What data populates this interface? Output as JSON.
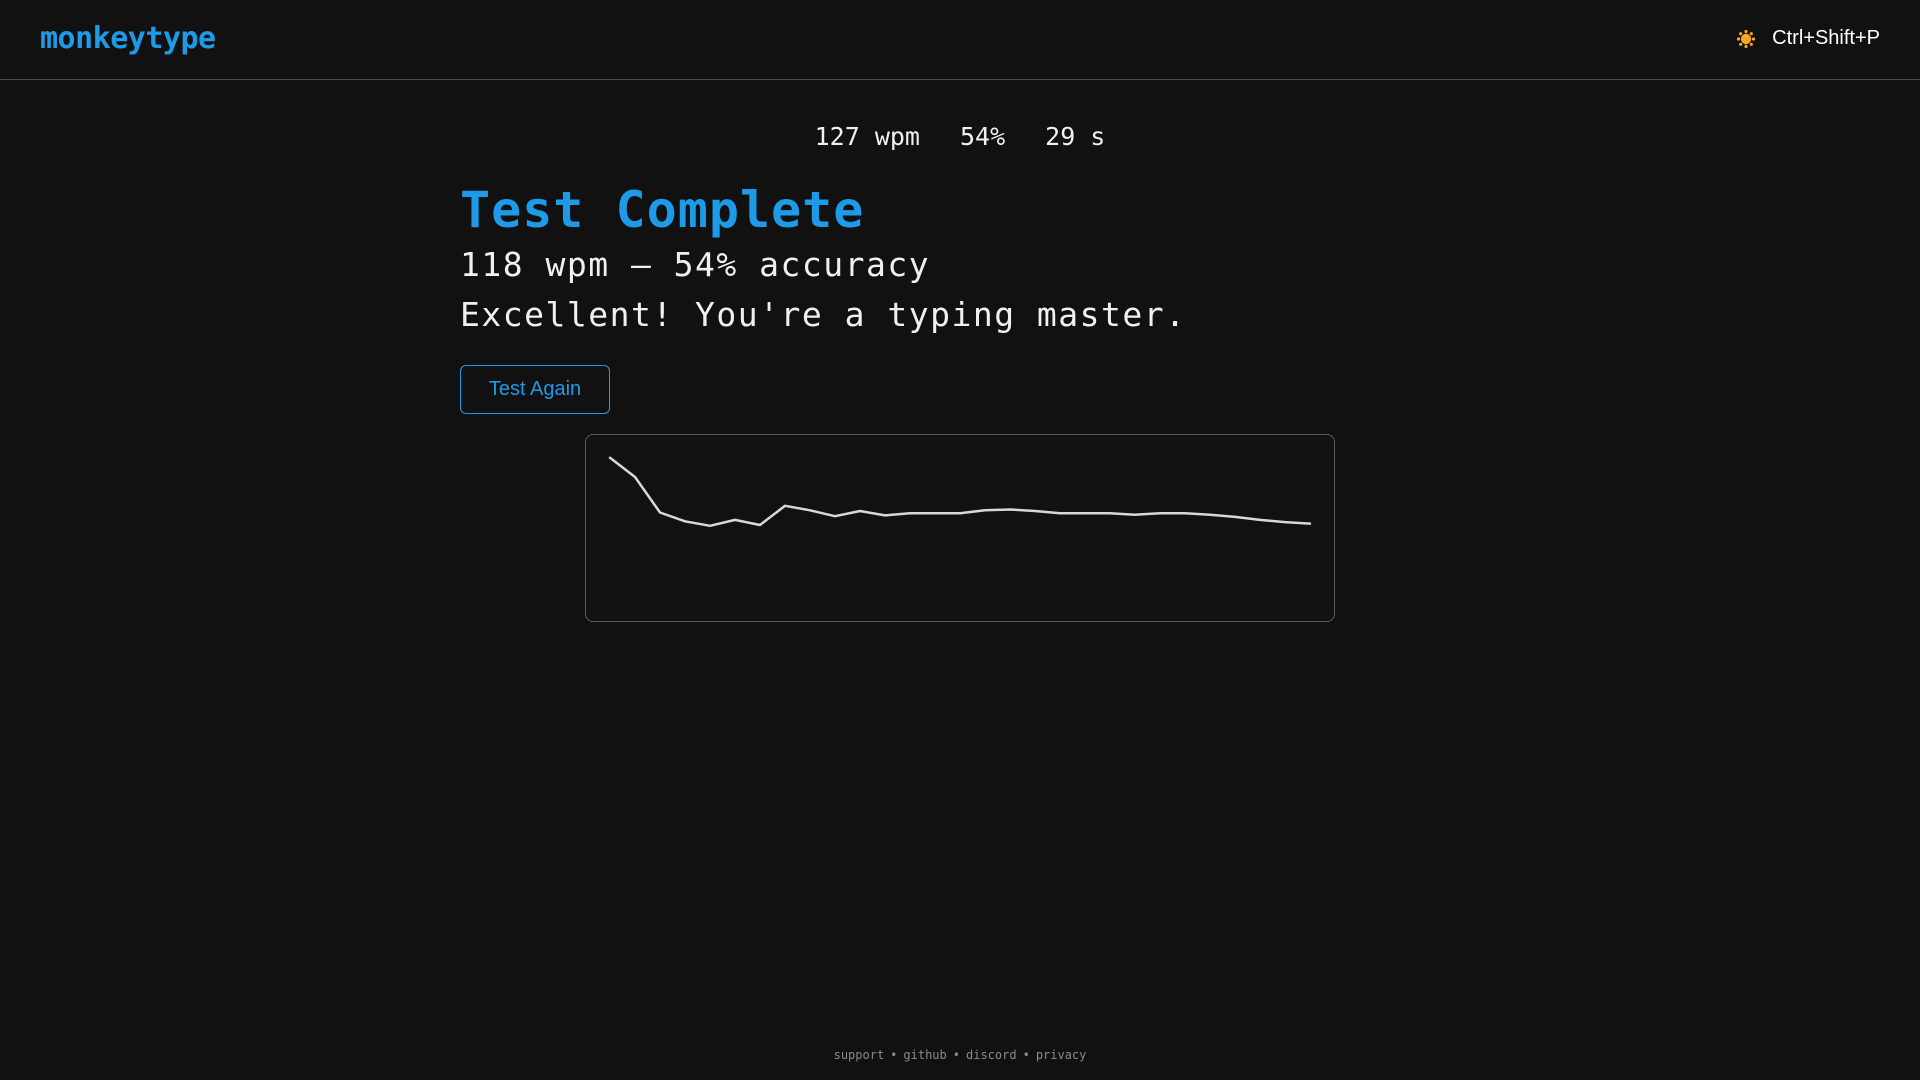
{
  "header": {
    "logo": "monkeytype",
    "theme_icon": "sun-icon",
    "shortcut": "Ctrl+Shift+P"
  },
  "live_stats": {
    "wpm": "127 wpm",
    "accuracy": "54%",
    "time": "29 s"
  },
  "results": {
    "title": "Test Complete",
    "summary": "118 wpm – 54% accuracy",
    "message": "Excellent! You're a typing master.",
    "button_label": "Test Again"
  },
  "chart_data": {
    "type": "line",
    "x": [
      0,
      1,
      2,
      3,
      4,
      5,
      6,
      7,
      8,
      9,
      10,
      11,
      12,
      13,
      14,
      15,
      16,
      17,
      18,
      19,
      20,
      21,
      22,
      23,
      24,
      25,
      26,
      27,
      28
    ],
    "series": [
      {
        "values": [
          210,
          184,
          136,
          124,
          118,
          126,
          119,
          145,
          139,
          131,
          138,
          132,
          135,
          135,
          135,
          139,
          140,
          138,
          135,
          135,
          135,
          133,
          135,
          135,
          133,
          130,
          126,
          123,
          121
        ]
      }
    ],
    "ylim": [
      0,
      230
    ],
    "grid": false,
    "colors": {
      "line": "#d8d8d8"
    }
  },
  "footer": {
    "links": [
      "support",
      "github",
      "discord",
      "privacy"
    ],
    "separator": "•"
  },
  "colors": {
    "accent": "#1e9be8",
    "background": "#111111",
    "text": "#f0f0f0",
    "theme_icon": "#f5a623"
  }
}
